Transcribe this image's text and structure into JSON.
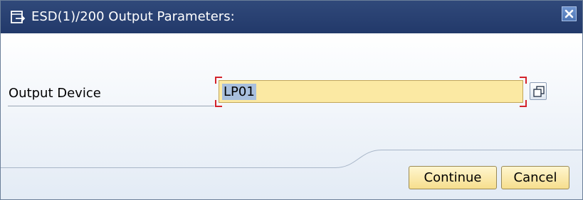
{
  "dialog": {
    "title": "ESD(1)/200 Output Parameters:",
    "title_icon": "dialog-icon",
    "close_icon": "close-icon"
  },
  "form": {
    "output_device": {
      "label": "Output Device",
      "value": "LP01",
      "value_selected": true,
      "field_state": "required",
      "value_help_icon": "value-help-icon"
    }
  },
  "buttons": {
    "continue_label": "Continue",
    "cancel_label": "Cancel"
  },
  "colors": {
    "titlebar": "#22396a",
    "input_bg": "#fbe9a3",
    "required_bracket": "#d4232b",
    "button_bg": "#f6de8d"
  }
}
